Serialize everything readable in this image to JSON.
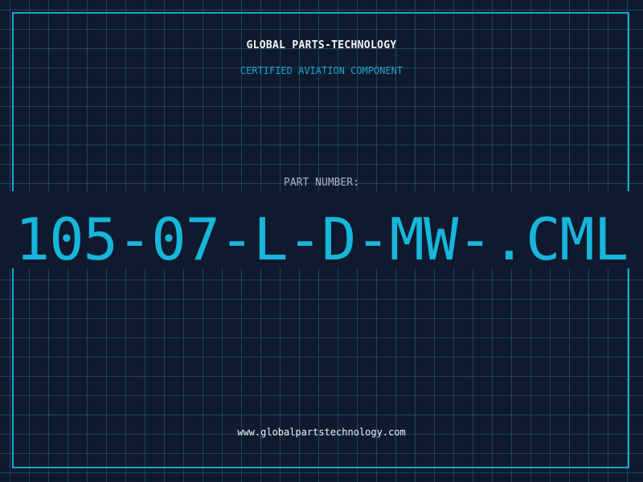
{
  "header": {
    "company": "GLOBAL PARTS-TECHNOLOGY",
    "subtitle": "CERTIFIED AVIATION COMPONENT"
  },
  "part": {
    "label": "PART NUMBER:",
    "number": "105-07-L-D-MW-.CML"
  },
  "footer": {
    "website": "www.globalpartstechnology.com"
  },
  "colors": {
    "background": "#0f1a2e",
    "grid": "#246882",
    "frame": "#1aa6c8",
    "accent": "#17b6da",
    "label": "#a9b4c2",
    "text": "#f2f5f7"
  }
}
